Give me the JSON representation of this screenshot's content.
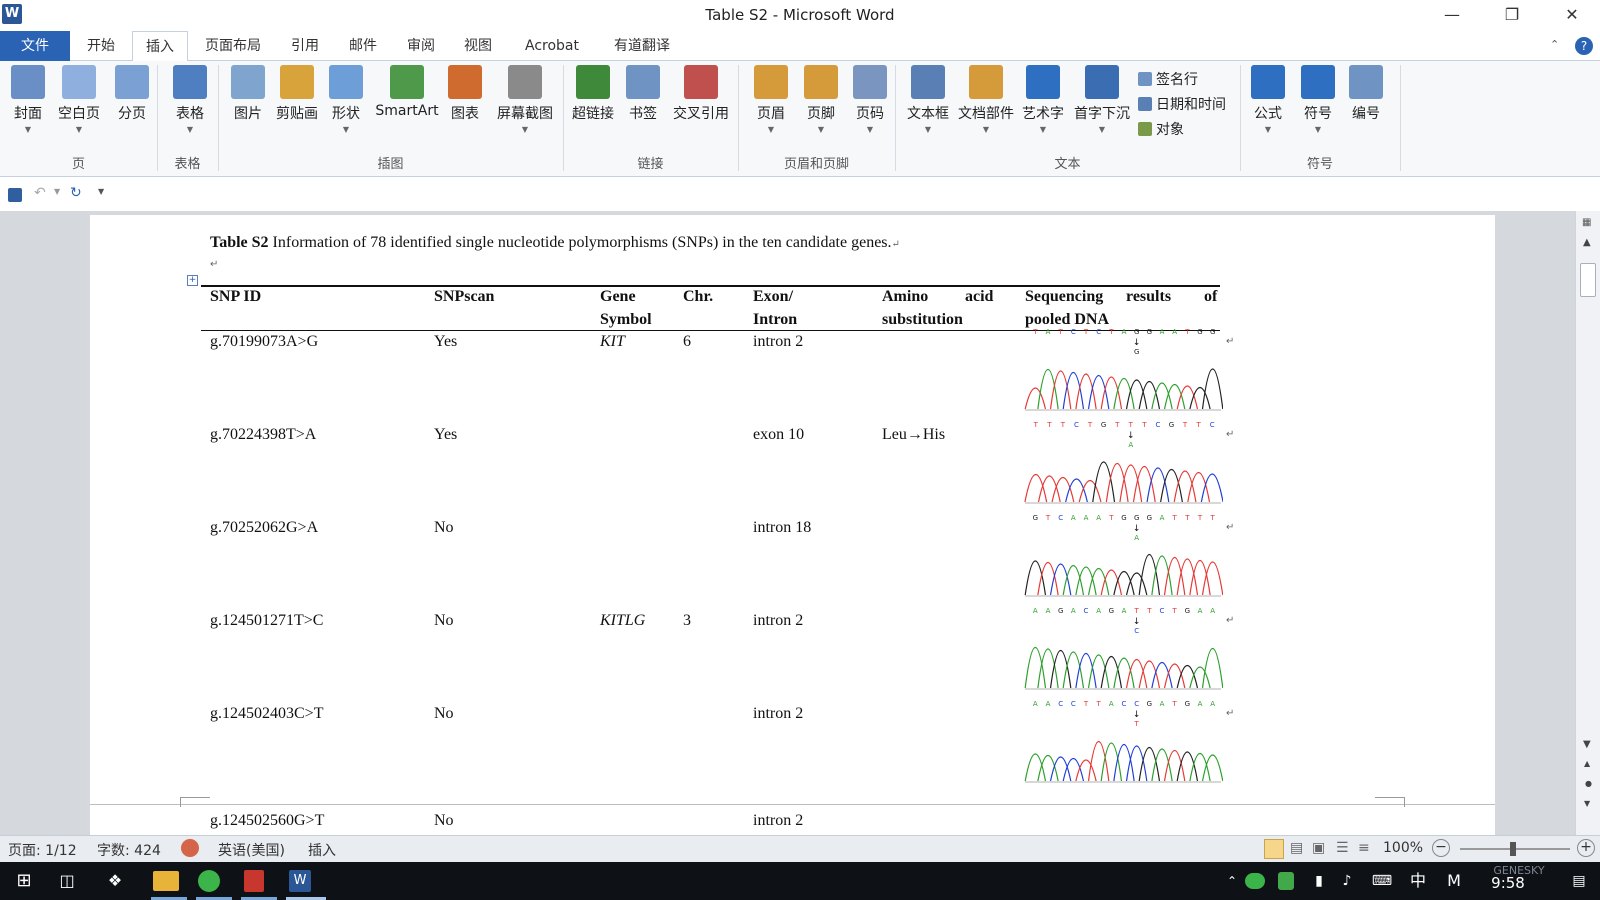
{
  "titlebar": {
    "app_icon": "W",
    "title": "Table S2 - Microsoft Word"
  },
  "menu": {
    "tabs": [
      {
        "label": "文件"
      },
      {
        "label": "开始"
      },
      {
        "label": "插入"
      },
      {
        "label": "页面布局"
      },
      {
        "label": "引用"
      },
      {
        "label": "邮件"
      },
      {
        "label": "审阅"
      },
      {
        "label": "视图"
      },
      {
        "label": "Acrobat"
      },
      {
        "label": "有道翻译"
      }
    ],
    "active_tab": "插入"
  },
  "ribbon": {
    "buttons": [
      {
        "label": "封面",
        "icon": "cover-page-icon",
        "color": "#6a8fc7"
      },
      {
        "label": "空白页",
        "icon": "blank-page-icon",
        "color": "#8fb0de"
      },
      {
        "label": "分页",
        "icon": "page-break-icon",
        "color": "#7aa0d4"
      },
      {
        "label": "表格",
        "icon": "table-icon",
        "color": "#4f7fc0"
      },
      {
        "label": "图片",
        "icon": "picture-icon",
        "color": "#7fa5cf"
      },
      {
        "label": "剪贴画",
        "icon": "clipart-icon",
        "color": "#d8a33a"
      },
      {
        "label": "形状",
        "icon": "shapes-icon",
        "color": "#6d9ed8"
      },
      {
        "label": "SmartArt",
        "icon": "smartart-icon",
        "color": "#4f9a4a"
      },
      {
        "label": "图表",
        "icon": "chart-icon",
        "color": "#d06b2f"
      },
      {
        "label": "屏幕截图",
        "icon": "screenshot-icon",
        "color": "#8a8a8a"
      },
      {
        "label": "超链接",
        "icon": "hyperlink-icon",
        "color": "#3f8a3a"
      },
      {
        "label": "书签",
        "icon": "bookmark-icon",
        "color": "#6f94c4"
      },
      {
        "label": "交叉引用",
        "icon": "cross-reference-icon",
        "color": "#c0504d"
      },
      {
        "label": "页眉",
        "icon": "header-icon",
        "color": "#d59b3a"
      },
      {
        "label": "页脚",
        "icon": "footer-icon",
        "color": "#d59b3a"
      },
      {
        "label": "页码",
        "icon": "page-number-icon",
        "color": "#7a96c0"
      },
      {
        "label": "文本框",
        "icon": "text-box-icon",
        "color": "#5a7fb5"
      },
      {
        "label": "文档部件",
        "icon": "quick-parts-icon",
        "color": "#d59b3a"
      },
      {
        "label": "艺术字",
        "icon": "wordart-icon",
        "color": "#2f6fc2"
      },
      {
        "label": "首字下沉",
        "icon": "drop-cap-icon",
        "color": "#3b6db3"
      },
      {
        "label": "公式",
        "icon": "equation-icon",
        "color": "#2f6fc2"
      },
      {
        "label": "符号",
        "icon": "symbol-icon",
        "color": "#2f6fc2"
      },
      {
        "label": "编号",
        "icon": "numbering-icon",
        "color": "#6f94c4"
      }
    ],
    "small_buttons": [
      {
        "label": "签名行",
        "icon": "signature-line-icon"
      },
      {
        "label": "日期和时间",
        "icon": "date-time-icon"
      },
      {
        "label": "对象",
        "icon": "object-icon"
      }
    ],
    "groups": [
      "页",
      "表格",
      "插图",
      "链接",
      "页眉和页脚",
      "文本",
      "符号"
    ]
  },
  "document": {
    "caption_bold": "Table S2",
    "caption_text": " Information of 78 identified single nucleotide polymorphisms (SNPs) in the ten candidate genes.",
    "headers": [
      "SNP ID",
      "SNPscan",
      "Gene",
      "Symbol",
      "Chr.",
      "Exon/",
      "Intron",
      "Amino",
      "acid",
      "substitution",
      "Sequencing",
      "results",
      "of",
      "pooled DNA"
    ],
    "rows": [
      {
        "snp": "g.70199073A>G",
        "scan": "Yes",
        "gene": "KIT",
        "chr": "6",
        "exon": "intron 2",
        "aa": "",
        "seq": "T A T C T C T A G G A A T G G",
        "alt": "G"
      },
      {
        "snp": "g.70224398T>A",
        "scan": "Yes",
        "gene": "",
        "chr": "",
        "exon": "exon 10",
        "aa": "Leu→His",
        "seq": "T T T C T G T T T C G T T C",
        "alt": "A"
      },
      {
        "snp": "g.70252062G>A",
        "scan": "No",
        "gene": "",
        "chr": "",
        "exon": "intron 18",
        "aa": "",
        "seq": "G T C A A A T G G G A T T T T",
        "alt": "A"
      },
      {
        "snp": "g.124501271T>C",
        "scan": "No",
        "gene": "KITLG",
        "chr": "3",
        "exon": "intron 2",
        "aa": "",
        "seq": "A A G A C A G A T T C T G A A",
        "alt": "C"
      },
      {
        "snp": "g.124502403C>T",
        "scan": "No",
        "gene": "",
        "chr": "",
        "exon": "intron 2",
        "aa": "",
        "seq": "A A C C T T A C C G A T G A A",
        "alt": "T"
      }
    ],
    "cutoff_row": {
      "snp": "g.124502560G>T",
      "scan": "No",
      "exon": "intron 2"
    }
  },
  "statusbar": {
    "page": "页面: 1/12",
    "words": "字数: 424",
    "language": "英语(美国)",
    "mode": "插入",
    "zoom": "100%"
  },
  "taskbar": {
    "time": "9:58",
    "ime": "中",
    "ime2": "M",
    "watermark": "GENESKY"
  },
  "colors": {
    "file_tab": "#2a63b4",
    "trace_a": "#2ca02c",
    "trace_c": "#1f3fd6",
    "trace_g": "#222222",
    "trace_t": "#e53935"
  }
}
